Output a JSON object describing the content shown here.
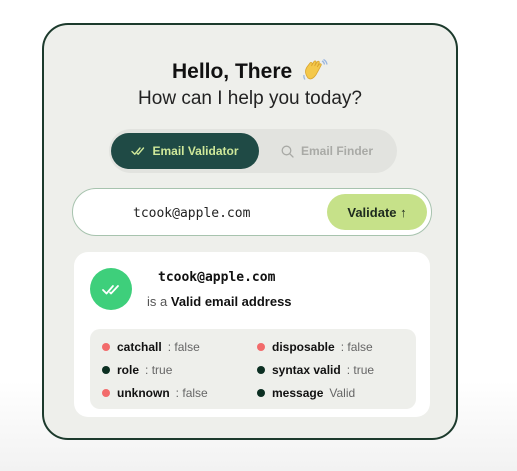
{
  "header": {
    "greeting": "Hello, There",
    "wave_icon": "waving-hand-icon",
    "subtitle": "How can I help you today?"
  },
  "tabs": [
    {
      "label": "Email Validator",
      "icon": "double-check-icon",
      "active": true
    },
    {
      "label": "Email Finder",
      "icon": "search-icon",
      "active": false
    }
  ],
  "search": {
    "value": "tcook@apple.com",
    "button_label": "Validate ↑"
  },
  "result": {
    "email": "tcook@apple.com",
    "prefix": "is a",
    "status": "Valid email address",
    "icon": "double-check-icon",
    "details": [
      {
        "key": "catchall",
        "sep": ":",
        "value": "false",
        "status": "negative"
      },
      {
        "key": "disposable",
        "sep": ":",
        "value": "false",
        "status": "negative"
      },
      {
        "key": "role",
        "sep": ":",
        "value": "true",
        "status": "positive"
      },
      {
        "key": "syntax valid",
        "sep": ":",
        "value": "true",
        "status": "positive"
      },
      {
        "key": "unknown",
        "sep": ":",
        "value": "false",
        "status": "negative"
      },
      {
        "key": "message",
        "sep": "",
        "value": "Valid",
        "status": "positive"
      }
    ]
  },
  "colors": {
    "card_bg": "#eeefeb",
    "border": "#1c3a2c",
    "active_tab": "#1f4a45",
    "active_tab_text": "#cfe89a",
    "validate_button": "#c6e189",
    "success": "#3ecf7b",
    "negative_dot": "#f26b6b",
    "positive_dot": "#0c2f22"
  }
}
